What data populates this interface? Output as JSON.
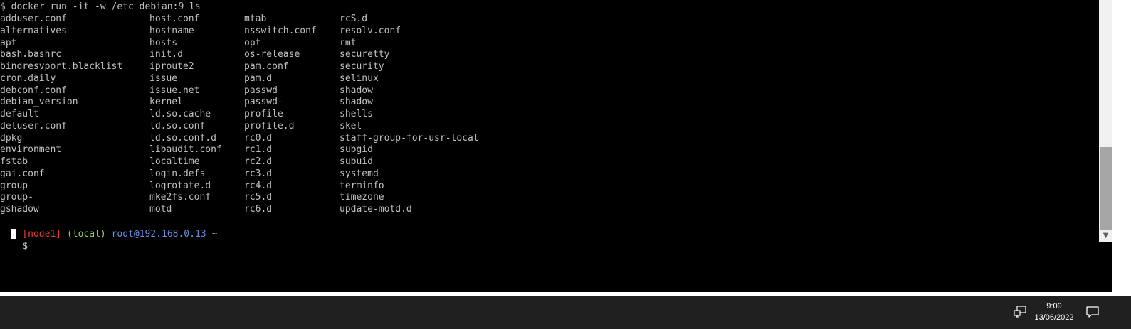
{
  "terminal": {
    "command_line": "$ docker run -it -w /etc debian:9 ls",
    "rows": [
      [
        "adduser.conf",
        "host.conf",
        "mtab",
        "rcS.d"
      ],
      [
        "alternatives",
        "hostname",
        "nsswitch.conf",
        "resolv.conf"
      ],
      [
        "apt",
        "hosts",
        "opt",
        "rmt"
      ],
      [
        "bash.bashrc",
        "init.d",
        "os-release",
        "securetty"
      ],
      [
        "bindresvport.blacklist",
        "iproute2",
        "pam.conf",
        "security"
      ],
      [
        "cron.daily",
        "issue",
        "pam.d",
        "selinux"
      ],
      [
        "debconf.conf",
        "issue.net",
        "passwd",
        "shadow"
      ],
      [
        "debian_version",
        "kernel",
        "passwd-",
        "shadow-"
      ],
      [
        "default",
        "ld.so.cache",
        "profile",
        "shells"
      ],
      [
        "deluser.conf",
        "ld.so.conf",
        "profile.d",
        "skel"
      ],
      [
        "dpkg",
        "ld.so.conf.d",
        "rc0.d",
        "staff-group-for-usr-local"
      ],
      [
        "environment",
        "libaudit.conf",
        "rc1.d",
        "subgid"
      ],
      [
        "fstab",
        "localtime",
        "rc2.d",
        "subuid"
      ],
      [
        "gai.conf",
        "login.defs",
        "rc3.d",
        "systemd"
      ],
      [
        "group",
        "logrotate.d",
        "rc4.d",
        "terminfo"
      ],
      [
        "group-",
        "mke2fs.conf",
        "rc5.d",
        "timezone"
      ],
      [
        "gshadow",
        "motd",
        "rc6.d",
        "update-motd.d"
      ]
    ],
    "prompt": {
      "node": "[node1]",
      "location": "(local)",
      "host": "root@192.168.0.13",
      "dir": "~",
      "symbol": "$"
    },
    "colors": {
      "text": "#c0c0c0",
      "node": "#e83c3c",
      "location": "#8ed15b",
      "host": "#6a8fd8",
      "background": "#000000"
    }
  },
  "taskbar": {
    "time": "9:09",
    "date": "13/06/2022",
    "network_icon": "network-icon",
    "notification_icon": "action-center-icon"
  }
}
